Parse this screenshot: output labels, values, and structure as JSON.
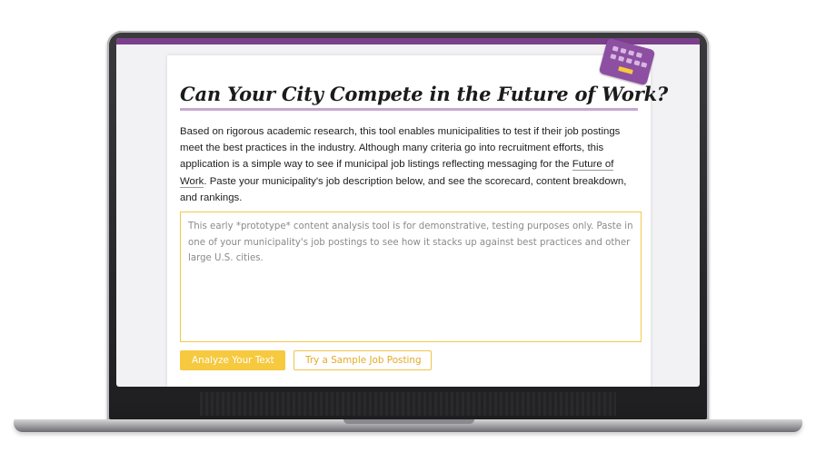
{
  "page": {
    "title": "Can Your City Compete in the Future of Work?",
    "intro_before_link": "Based on rigorous academic research, this tool enables municipalities to test if their job postings meet the best practices in the industry. Although many criteria go into recruitment efforts, this application is a simple way to see if municipal job listings reflecting messaging for the ",
    "intro_link": "Future of Work",
    "intro_after_link": ". Paste your municipality's job description below, and see the scorecard, content breakdown, and rankings."
  },
  "input": {
    "value": "",
    "placeholder": "This early *prototype* content analysis tool is for demonstrative, testing purposes only. Paste in one of your municipality's job postings to see how it stacks up against best practices and other large U.S. cities."
  },
  "buttons": {
    "analyze_label": "Analyze Your Text",
    "sample_label": "Try a Sample Job Posting"
  },
  "icons": {
    "badge": "keyboard-icon"
  },
  "colors": {
    "accent_purple": "#7b3f8c",
    "title_rule": "#c6a9cf",
    "accent_yellow": "#f6c93f"
  }
}
